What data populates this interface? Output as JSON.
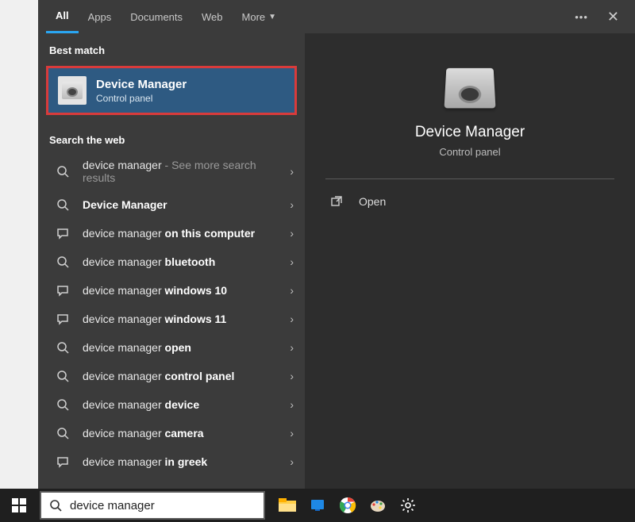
{
  "tabs": {
    "all": "All",
    "apps": "Apps",
    "documents": "Documents",
    "web": "Web",
    "more": "More"
  },
  "sections": {
    "best_match": "Best match",
    "search_web": "Search the web"
  },
  "best_match": {
    "title": "Device Manager",
    "subtitle": "Control panel"
  },
  "web_results": [
    {
      "icon": "search",
      "prefix": "device manager",
      "bold": "",
      "suffix": " - See more search results"
    },
    {
      "icon": "search",
      "prefix": "",
      "bold": "Device Manager",
      "suffix": ""
    },
    {
      "icon": "chat",
      "prefix": "device manager ",
      "bold": "on this computer",
      "suffix": ""
    },
    {
      "icon": "search",
      "prefix": "device manager ",
      "bold": "bluetooth",
      "suffix": ""
    },
    {
      "icon": "chat",
      "prefix": "device manager ",
      "bold": "windows 10",
      "suffix": ""
    },
    {
      "icon": "chat",
      "prefix": "device manager ",
      "bold": "windows 11",
      "suffix": ""
    },
    {
      "icon": "search",
      "prefix": "device manager ",
      "bold": "open",
      "suffix": ""
    },
    {
      "icon": "search",
      "prefix": "device manager ",
      "bold": "control panel",
      "suffix": ""
    },
    {
      "icon": "search",
      "prefix": "device manager ",
      "bold": "device",
      "suffix": ""
    },
    {
      "icon": "search",
      "prefix": "device manager ",
      "bold": "camera",
      "suffix": ""
    },
    {
      "icon": "chat",
      "prefix": "device manager ",
      "bold": "in greek",
      "suffix": ""
    }
  ],
  "preview": {
    "title": "Device Manager",
    "subtitle": "Control panel",
    "open": "Open"
  },
  "search_value": "device manager",
  "colors": {
    "highlight_border": "#d93b3b",
    "selected_bg": "#2e5a82",
    "tab_underline": "#2aa6f2"
  },
  "taskbar_icons": [
    "file-explorer",
    "microsoft-edge",
    "google-chrome",
    "paint",
    "settings"
  ]
}
